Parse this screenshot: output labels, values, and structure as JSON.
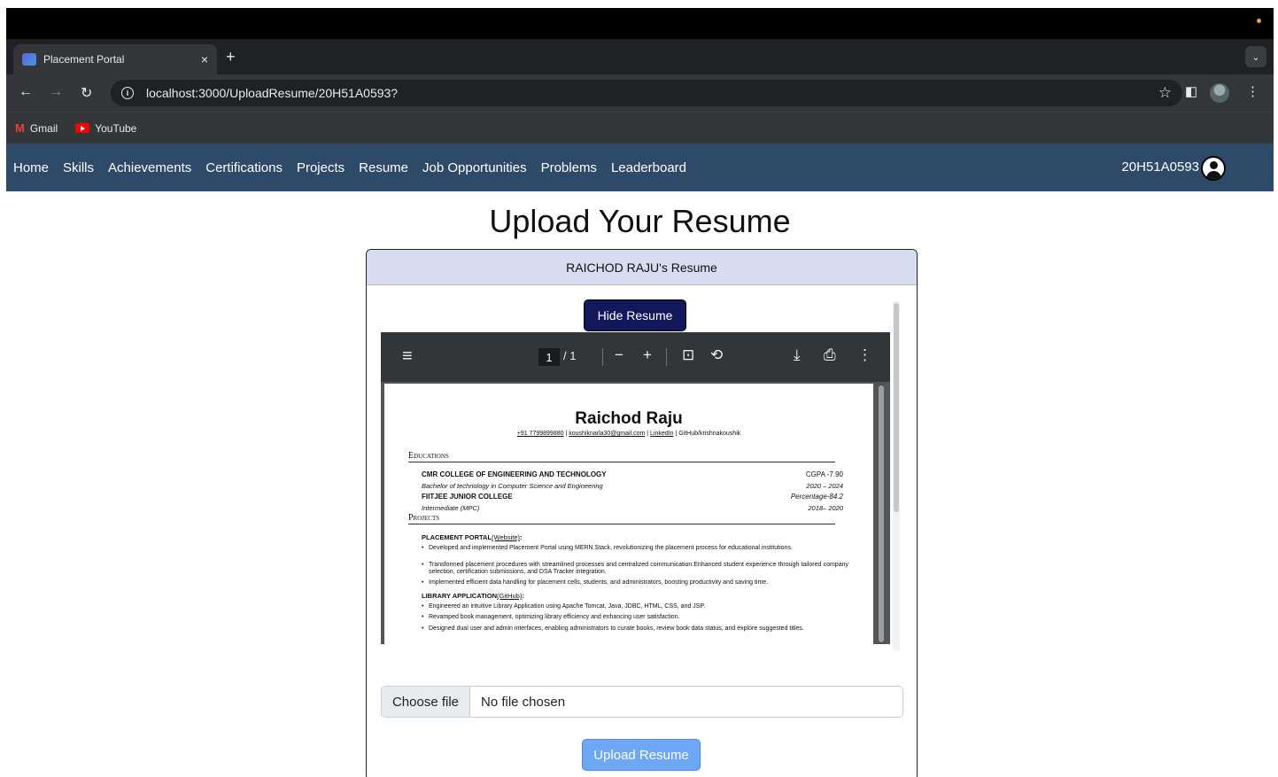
{
  "browser": {
    "tab_title": "Placement Portal",
    "tab_close": "×",
    "new_tab": "+",
    "url": "localhost:3000/UploadResume/20H51A0593?",
    "bookmarks": [
      {
        "label": "Gmail",
        "icon": "gmail-icon"
      },
      {
        "label": "YouTube",
        "icon": "youtube-icon"
      }
    ]
  },
  "navbar": {
    "links": [
      "Home",
      "Skills",
      "Achievements",
      "Certifications",
      "Projects",
      "Resume",
      "Job Opportunities",
      "Problems",
      "Leaderboard"
    ],
    "user_id": "20H51A0593"
  },
  "page": {
    "title": "Upload Your Resume",
    "card_header": "RAICHOD RAJU's Resume",
    "hide_button": "Hide Resume",
    "file_button": "Choose file",
    "file_status": "No file chosen",
    "upload_button": "Upload Resume"
  },
  "pdf_viewer": {
    "current_page": "1",
    "total_pages": "/ 1",
    "icons": [
      "menu-icon",
      "zoom-out-icon",
      "zoom-in-icon",
      "fit-page-icon",
      "rotate-icon",
      "download-icon",
      "print-icon",
      "more-icon"
    ]
  },
  "resume": {
    "name": "Raichod Raju",
    "phone": "+91 7799899880",
    "email": "koushiknarla30@gmail.com",
    "linkedin": "LinkedIn",
    "github": "GitHub/krishnakoushik",
    "educations_heading": "Educations",
    "education": [
      {
        "school": "CMR COLLEGE OF ENGINEERING AND TECHNOLOGY",
        "score": "CGPA -7.90",
        "degree": "Bachelor of technology in Computer Science and Engineering",
        "years": "2020 – 2024"
      },
      {
        "school": "FIITJEE JUNIOR COLLEGE",
        "score": "Percentage-84.2",
        "degree": "Intermediate (MPC)",
        "years": "2018– 2020"
      }
    ],
    "projects_heading": "Projects",
    "project1_title": "PLACEMENT PORTAL",
    "project1_link": "(Website)",
    "project1_bullets": [
      "Developed and implemented Placement Portal using MERN Stack, revolutionizing the placement process for educational institutions.",
      "Transformed placement procedures with streamlined processes and centralized communication.Enhanced student experience through tailored company selection, certification submissions, and DSA Tracker integration.",
      "Implemented efficient data handling for placement cells, students, and administrators, boosting productivity and saving time."
    ],
    "project2_title": "LIBRARY APPLICATION",
    "project2_link": "(GitHub)",
    "project2_bullets": [
      "Engineered an intuitive Library Application using Apache Tomcat, Java, JDBC, HTML, CSS, and JSP.",
      "Revamped book management, optimizing library efficiency and enhancing user satisfaction.",
      "Designed dual user and admin interfaces, enabling administrators to curate books, review book data status, and explore suggested titles."
    ]
  }
}
